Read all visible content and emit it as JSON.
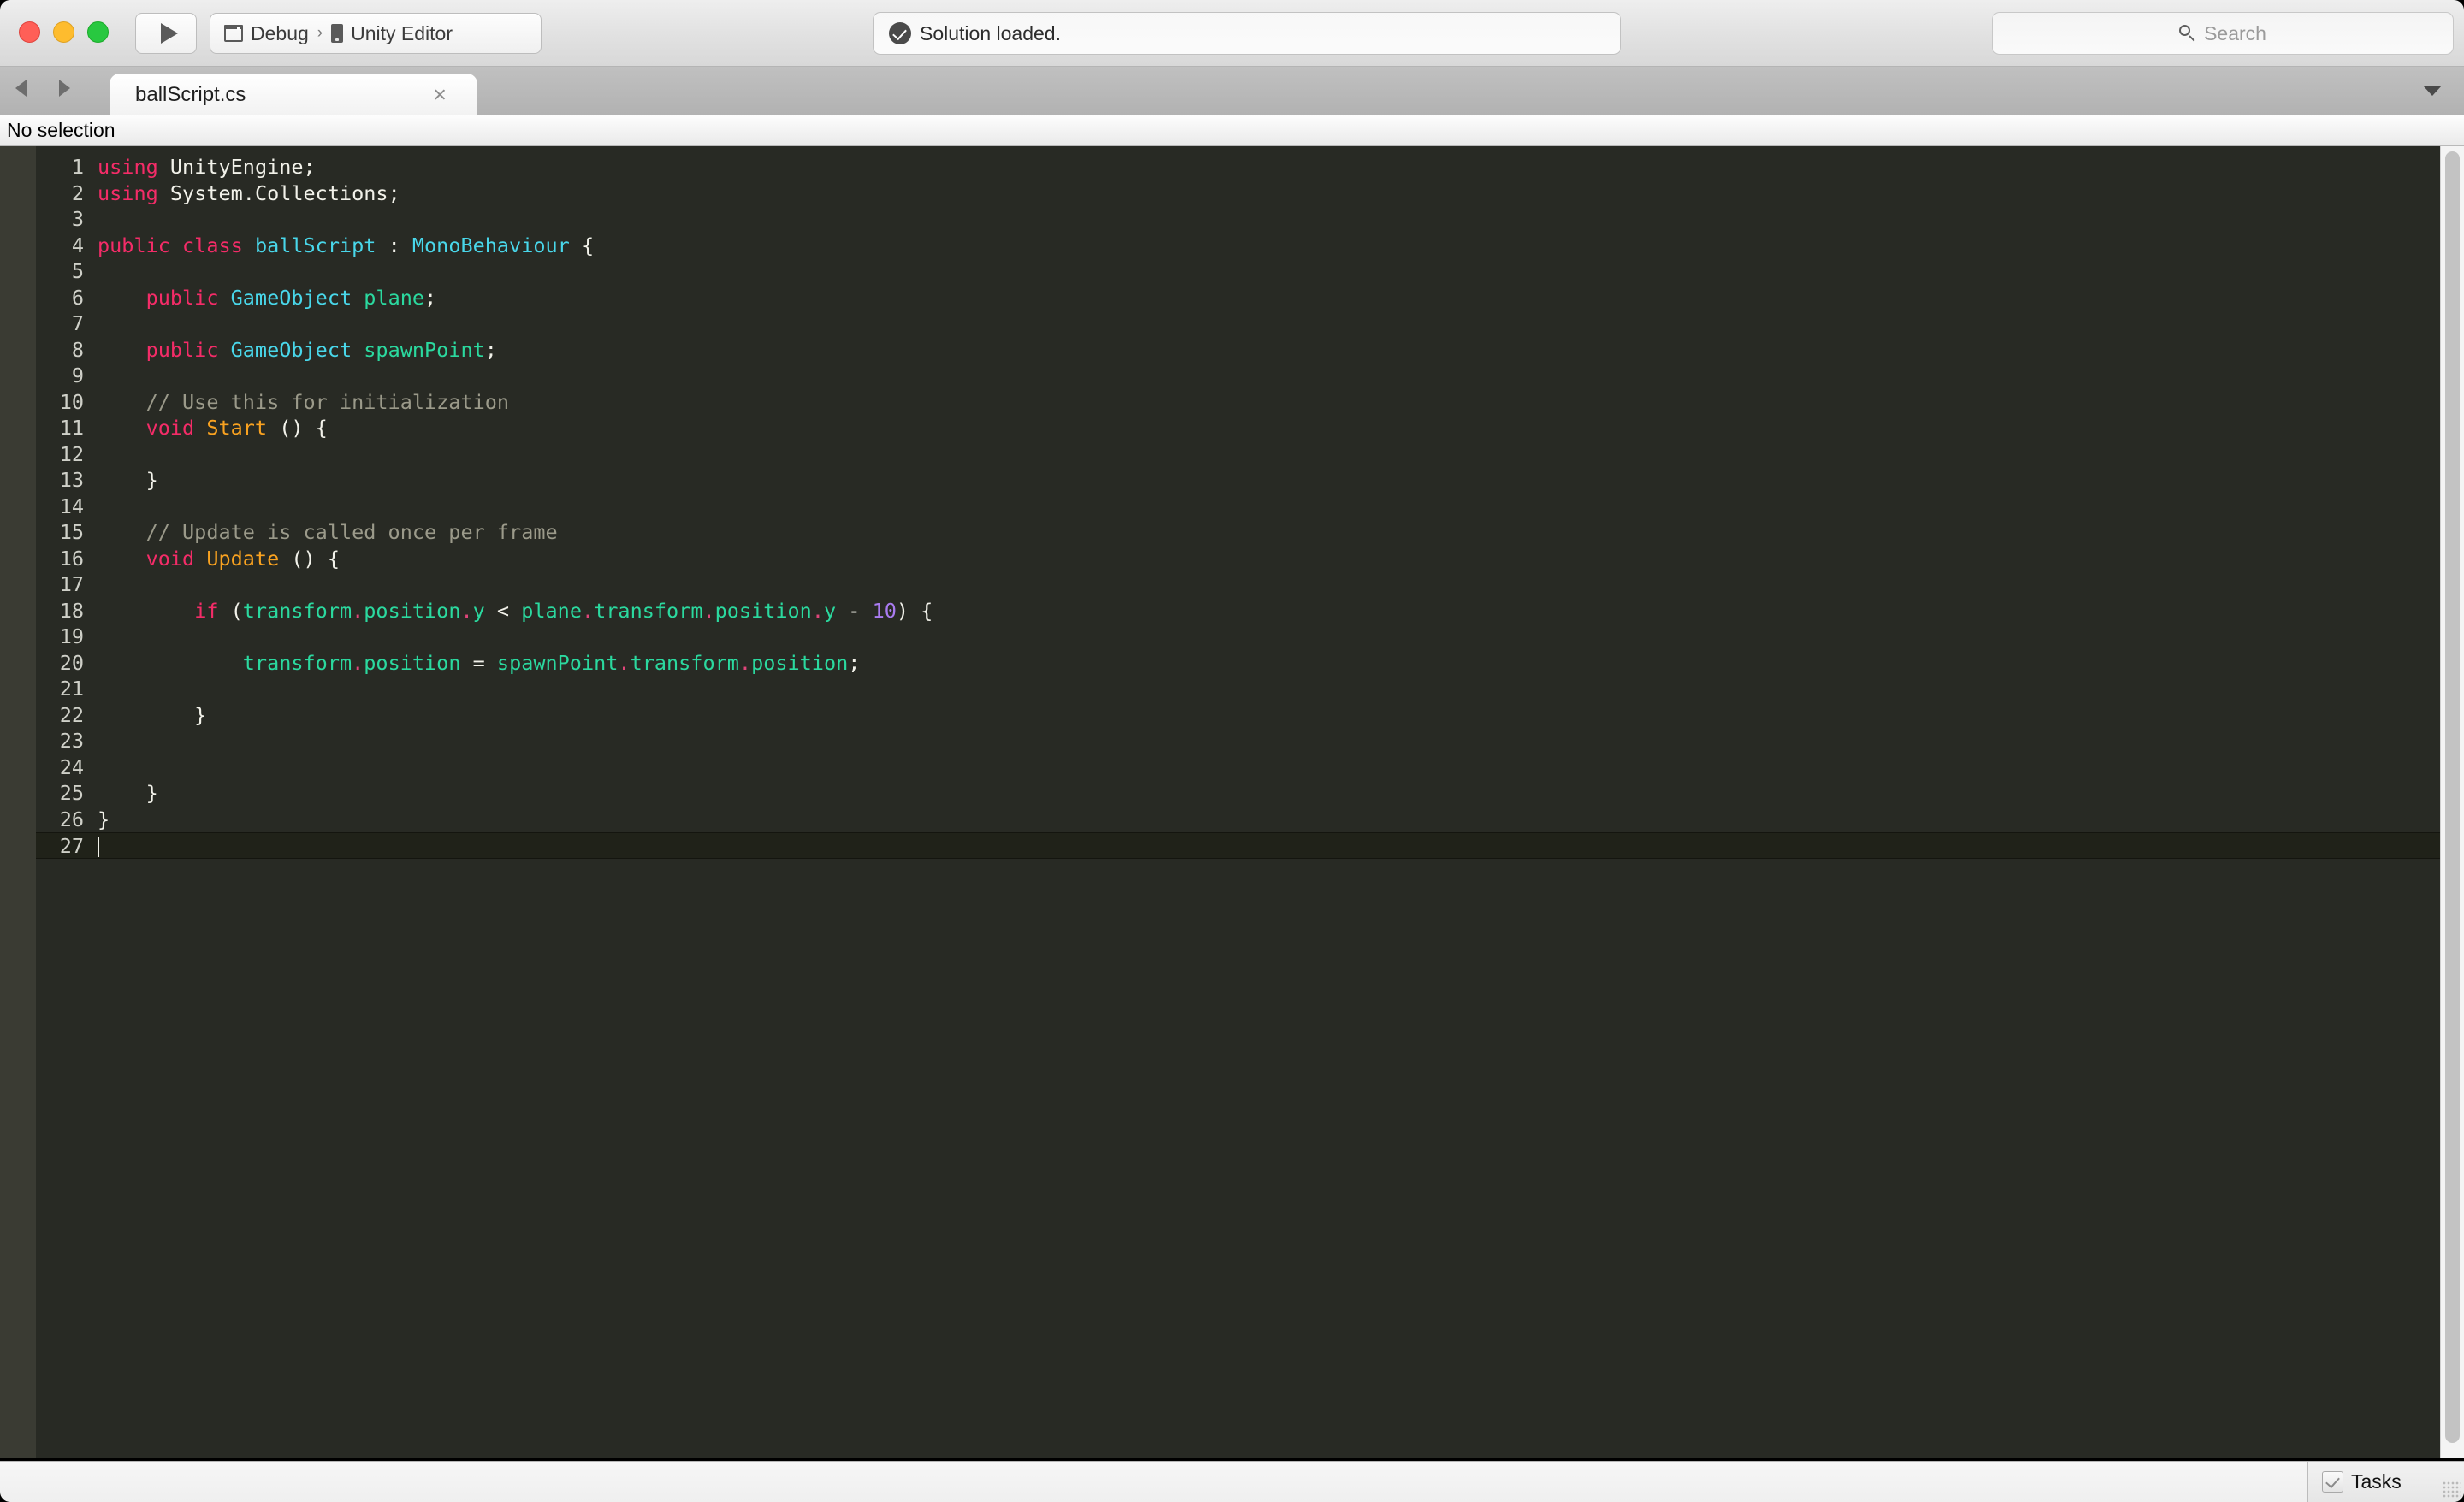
{
  "window": {
    "traffic_lights": [
      "close",
      "minimize",
      "zoom"
    ],
    "colors": {
      "close": "#ff5f57",
      "minimize": "#febc2e",
      "zoom": "#28c840",
      "editor_background": "#282a24",
      "gutter_background": "#3a3b33",
      "current_line_background": "#202219",
      "keyword": "#f42c68",
      "type": "#49d7ea",
      "identifier": "#2bd99f",
      "function": "#f9a220",
      "comment": "#9b9a8a",
      "number": "#a97bf0",
      "plain": "#f2f2ea"
    }
  },
  "toolbar": {
    "run_button_icon": "play-icon",
    "target": {
      "configuration": "Debug",
      "separator": "›",
      "device": "Unity Editor",
      "config_icon": "window-icon",
      "device_icon": "device-icon"
    },
    "status": {
      "icon": "check-circle-icon",
      "text": "Solution loaded."
    },
    "search": {
      "icon": "search-icon",
      "placeholder": "Search",
      "value": ""
    }
  },
  "tabbar": {
    "back_label": "Back",
    "forward_label": "Forward",
    "tabs": [
      {
        "label": "ballScript.cs",
        "active": true,
        "close_label": "×"
      }
    ],
    "dropdown_icon": "chevron-down-icon"
  },
  "pathbar": {
    "selection": "No selection"
  },
  "editor": {
    "current_line": 27,
    "caret_line": 27,
    "lines": [
      {
        "n": 1,
        "tokens": [
          {
            "t": "kw",
            "s": "using"
          },
          {
            "t": "plain",
            "s": " "
          },
          {
            "t": "plain",
            "s": "UnityEngine;"
          }
        ]
      },
      {
        "n": 2,
        "tokens": [
          {
            "t": "kw",
            "s": "using"
          },
          {
            "t": "plain",
            "s": " "
          },
          {
            "t": "plain",
            "s": "System.Collections;"
          }
        ]
      },
      {
        "n": 3,
        "tokens": []
      },
      {
        "n": 4,
        "tokens": [
          {
            "t": "kw",
            "s": "public class"
          },
          {
            "t": "plain",
            "s": " "
          },
          {
            "t": "type",
            "s": "ballScript"
          },
          {
            "t": "plain",
            "s": " : "
          },
          {
            "t": "type",
            "s": "MonoBehaviour"
          },
          {
            "t": "plain",
            "s": " {"
          }
        ]
      },
      {
        "n": 5,
        "tokens": []
      },
      {
        "n": 6,
        "tokens": [
          {
            "t": "plain",
            "s": "    "
          },
          {
            "t": "kw",
            "s": "public"
          },
          {
            "t": "plain",
            "s": " "
          },
          {
            "t": "type",
            "s": "GameObject"
          },
          {
            "t": "plain",
            "s": " "
          },
          {
            "t": "id",
            "s": "plane"
          },
          {
            "t": "plain",
            "s": ";"
          }
        ]
      },
      {
        "n": 7,
        "tokens": []
      },
      {
        "n": 8,
        "tokens": [
          {
            "t": "plain",
            "s": "    "
          },
          {
            "t": "kw",
            "s": "public"
          },
          {
            "t": "plain",
            "s": " "
          },
          {
            "t": "type",
            "s": "GameObject"
          },
          {
            "t": "plain",
            "s": " "
          },
          {
            "t": "id",
            "s": "spawnPoint"
          },
          {
            "t": "plain",
            "s": ";"
          }
        ]
      },
      {
        "n": 9,
        "tokens": []
      },
      {
        "n": 10,
        "tokens": [
          {
            "t": "plain",
            "s": "    "
          },
          {
            "t": "com",
            "s": "// Use this for initialization"
          }
        ]
      },
      {
        "n": 11,
        "tokens": [
          {
            "t": "plain",
            "s": "    "
          },
          {
            "t": "kw",
            "s": "void"
          },
          {
            "t": "plain",
            "s": " "
          },
          {
            "t": "fn",
            "s": "Start"
          },
          {
            "t": "plain",
            "s": " () {"
          }
        ]
      },
      {
        "n": 12,
        "tokens": []
      },
      {
        "n": 13,
        "tokens": [
          {
            "t": "plain",
            "s": "    }"
          }
        ]
      },
      {
        "n": 14,
        "tokens": []
      },
      {
        "n": 15,
        "tokens": [
          {
            "t": "plain",
            "s": "    "
          },
          {
            "t": "com",
            "s": "// Update is called once per frame"
          }
        ]
      },
      {
        "n": 16,
        "tokens": [
          {
            "t": "plain",
            "s": "    "
          },
          {
            "t": "kw",
            "s": "void"
          },
          {
            "t": "plain",
            "s": " "
          },
          {
            "t": "fn",
            "s": "Update"
          },
          {
            "t": "plain",
            "s": " () {"
          }
        ]
      },
      {
        "n": 17,
        "tokens": []
      },
      {
        "n": 18,
        "tokens": [
          {
            "t": "plain",
            "s": "        "
          },
          {
            "t": "kw",
            "s": "if"
          },
          {
            "t": "plain",
            "s": " ("
          },
          {
            "t": "id",
            "s": "transform"
          },
          {
            "t": "dot",
            "s": "."
          },
          {
            "t": "id",
            "s": "position"
          },
          {
            "t": "dot",
            "s": "."
          },
          {
            "t": "id",
            "s": "y"
          },
          {
            "t": "plain",
            "s": " < "
          },
          {
            "t": "id",
            "s": "plane"
          },
          {
            "t": "dot",
            "s": "."
          },
          {
            "t": "id",
            "s": "transform"
          },
          {
            "t": "dot",
            "s": "."
          },
          {
            "t": "id",
            "s": "position"
          },
          {
            "t": "dot",
            "s": "."
          },
          {
            "t": "id",
            "s": "y"
          },
          {
            "t": "plain",
            "s": " - "
          },
          {
            "t": "num",
            "s": "10"
          },
          {
            "t": "plain",
            "s": ") {"
          }
        ]
      },
      {
        "n": 19,
        "tokens": []
      },
      {
        "n": 20,
        "tokens": [
          {
            "t": "plain",
            "s": "            "
          },
          {
            "t": "id",
            "s": "transform"
          },
          {
            "t": "dot",
            "s": "."
          },
          {
            "t": "id",
            "s": "position"
          },
          {
            "t": "plain",
            "s": " = "
          },
          {
            "t": "id",
            "s": "spawnPoint"
          },
          {
            "t": "dot",
            "s": "."
          },
          {
            "t": "id",
            "s": "transform"
          },
          {
            "t": "dot",
            "s": "."
          },
          {
            "t": "id",
            "s": "position"
          },
          {
            "t": "plain",
            "s": ";"
          }
        ]
      },
      {
        "n": 21,
        "tokens": []
      },
      {
        "n": 22,
        "tokens": [
          {
            "t": "plain",
            "s": "        }"
          }
        ]
      },
      {
        "n": 23,
        "tokens": []
      },
      {
        "n": 24,
        "tokens": []
      },
      {
        "n": 25,
        "tokens": [
          {
            "t": "plain",
            "s": "    }"
          }
        ]
      },
      {
        "n": 26,
        "tokens": [
          {
            "t": "plain",
            "s": "}"
          }
        ]
      },
      {
        "n": 27,
        "tokens": []
      }
    ]
  },
  "statusbar": {
    "tasks": {
      "icon": "checkbox-checked-icon",
      "label": "Tasks"
    },
    "resize_grip_icon": "resize-grip-icon"
  }
}
